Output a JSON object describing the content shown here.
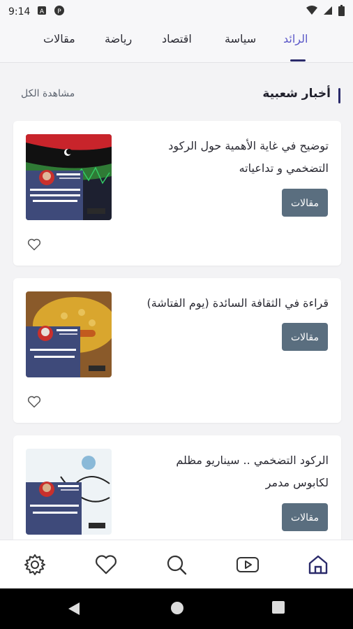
{
  "status_bar": {
    "time": "9:14"
  },
  "tabs": [
    {
      "label": "الرائد",
      "active": true
    },
    {
      "label": "سياسة",
      "active": false
    },
    {
      "label": "اقتصاد",
      "active": false
    },
    {
      "label": "رياضة",
      "active": false
    },
    {
      "label": "مقالات",
      "active": false
    }
  ],
  "section": {
    "title": "أخبار شعبية",
    "view_all": "مشاهدة الكل"
  },
  "cards": [
    {
      "title": "توضيح في غاية الأهمية حول الركود التضخمي و تداعياته",
      "category": "مقالات",
      "favorited": false
    },
    {
      "title": "قراءة في الثقافة السائدة (يوم الفتاشة)",
      "category": "مقالات",
      "favorited": false
    },
    {
      "title": "الركود التضخمي .. سيناريو مظلم لكابوس مدمر",
      "category": "مقالات",
      "favorited": false
    }
  ],
  "bottom_nav": [
    {
      "icon": "home-icon",
      "active": true
    },
    {
      "icon": "video-icon",
      "active": false
    },
    {
      "icon": "search-icon",
      "active": false
    },
    {
      "icon": "heart-icon",
      "active": false
    },
    {
      "icon": "settings-icon",
      "active": false
    }
  ],
  "colors": {
    "accent": "#5a57c8",
    "indicator": "#2a2a6a",
    "button": "#5a6e7f"
  }
}
